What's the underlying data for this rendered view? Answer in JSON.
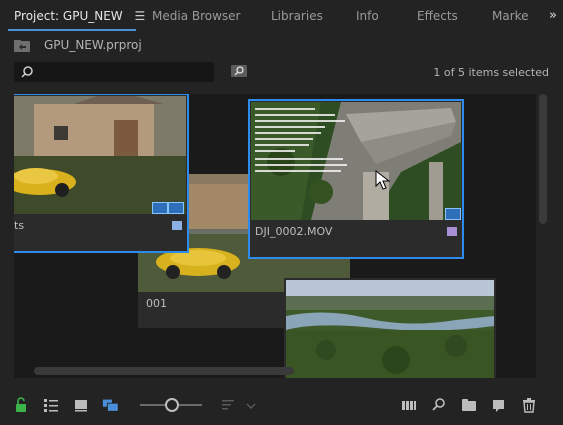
{
  "tabs": [
    {
      "label": "Project: GPU_NEW",
      "active": true
    },
    {
      "label": "Media Browser"
    },
    {
      "label": "Libraries"
    },
    {
      "label": "Info"
    },
    {
      "label": "Effects"
    },
    {
      "label": "Marke"
    }
  ],
  "tab_menu_icon": "hamburger-menu-icon",
  "overflow_label": "»",
  "project": {
    "file_name": "GPU_NEW.prproj"
  },
  "search": {
    "placeholder": ""
  },
  "selection_status": "1 of 5 items selected",
  "clips": [
    {
      "name": "ts",
      "selected": true,
      "label_color": "#8ab0e6"
    },
    {
      "name": "001",
      "selected": false
    },
    {
      "name": "DJI_0002.MOV",
      "selected": true,
      "label_color": "#a88fd6"
    },
    {
      "name": "",
      "selected": false
    }
  ],
  "bottom_toolbar": {
    "left": [
      "lock-icon",
      "list-view-icon",
      "icon-view-icon",
      "freeform-view-icon",
      "zoom-slider",
      "sort-icon"
    ],
    "right": [
      "automate-to-sequence-icon",
      "find-icon",
      "new-bin-icon",
      "new-item-icon",
      "trash-icon"
    ]
  },
  "colors": {
    "accent": "#2d8ceb",
    "lock": "#3bb54a"
  }
}
